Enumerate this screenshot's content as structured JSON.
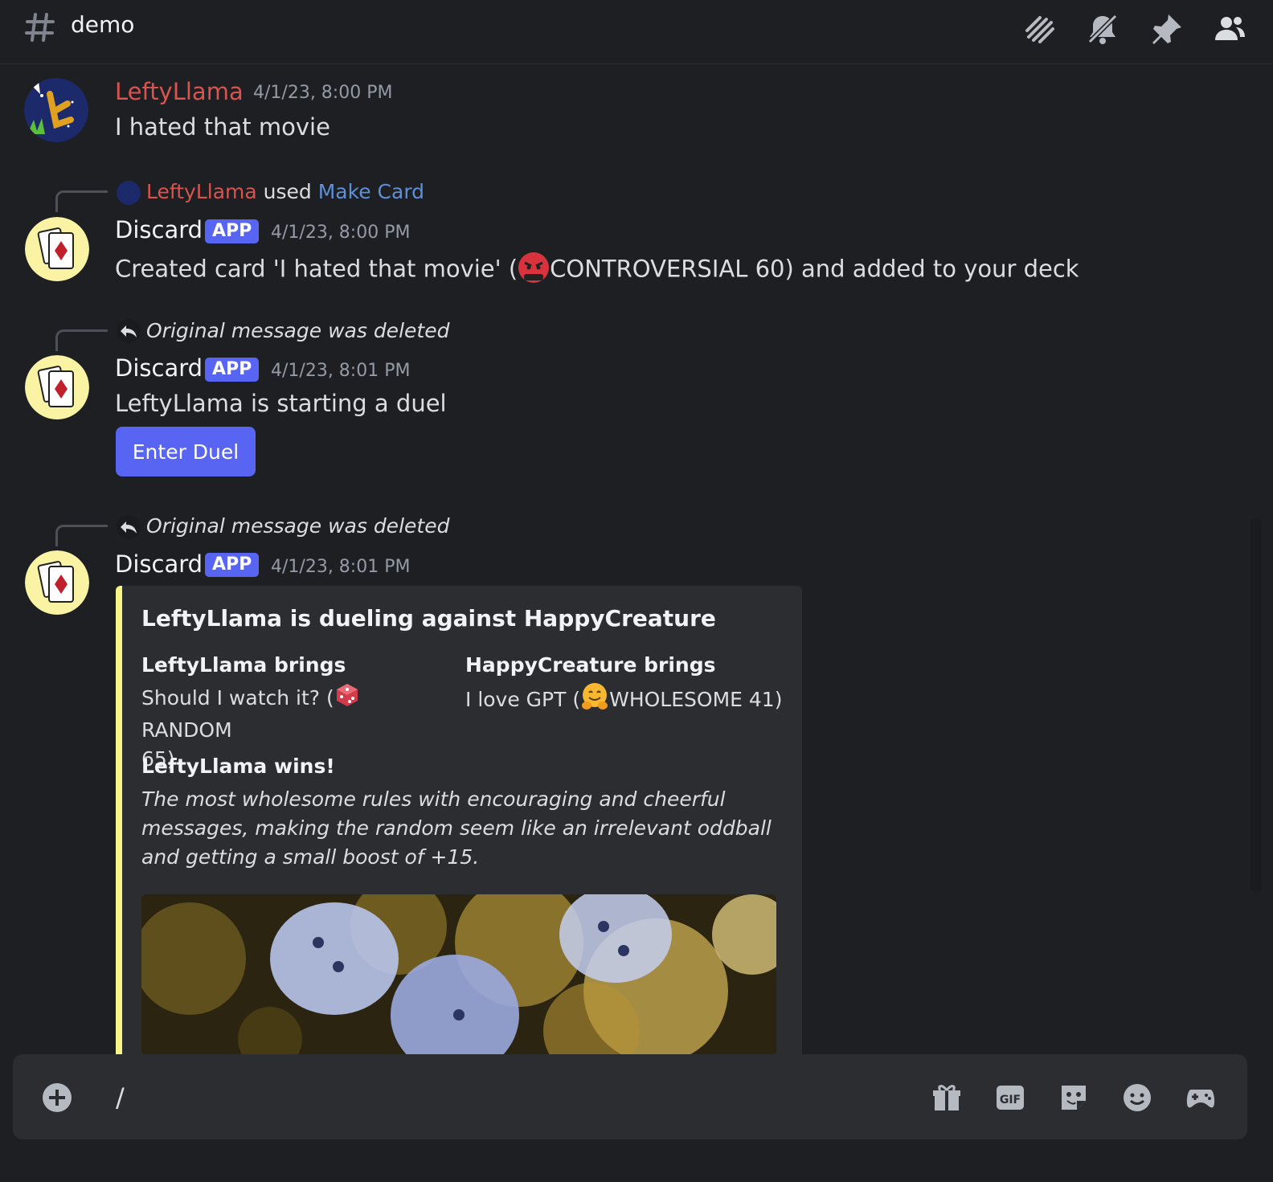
{
  "header": {
    "channel_name": "demo"
  },
  "messages": [
    {
      "author": "LeftyLlama",
      "timestamp": "4/1/23, 8:00 PM",
      "text": "I hated that movie"
    },
    {
      "reply_user": "LeftyLlama",
      "reply_used": "used",
      "reply_command": "Make Card",
      "author": "Discard",
      "badge": "APP",
      "timestamp": "4/1/23, 8:00 PM",
      "text_before": "Created card 'I hated that movie' (",
      "text_after": "CONTROVERSIAL 60) and added to your deck"
    },
    {
      "reply_text": "Original message was deleted",
      "author": "Discard",
      "badge": "APP",
      "timestamp": "4/1/23, 8:01 PM",
      "text": "LeftyLlama is starting a duel",
      "button_label": "Enter Duel"
    },
    {
      "reply_text": "Original message was deleted",
      "author": "Discard",
      "badge": "APP",
      "timestamp": "4/1/23, 8:01 PM",
      "embed": {
        "title": "LeftyLlama is dueling against HappyCreature",
        "field1_name": "LeftyLlama brings",
        "field1_value_a": "Should I watch it? (",
        "field1_value_b": " RANDOM",
        "field1_value_c": "65)",
        "field2_name": "HappyCreature brings",
        "field2_value_a": "I love GPT (",
        "field2_value_b": "WHOLESOME 41)",
        "result": "LeftyLlama wins!",
        "description": "The most wholesome rules with encouraging and cheerful messages, making the random seem like an irrelevant oddball and getting a small boost of +15."
      }
    }
  ],
  "composer": {
    "value": "/"
  },
  "colors": {
    "username_red": "#d9534f",
    "link_blue": "#5e8fd9",
    "brand": "#5865f2",
    "embed_accent": "#f7f58a"
  }
}
